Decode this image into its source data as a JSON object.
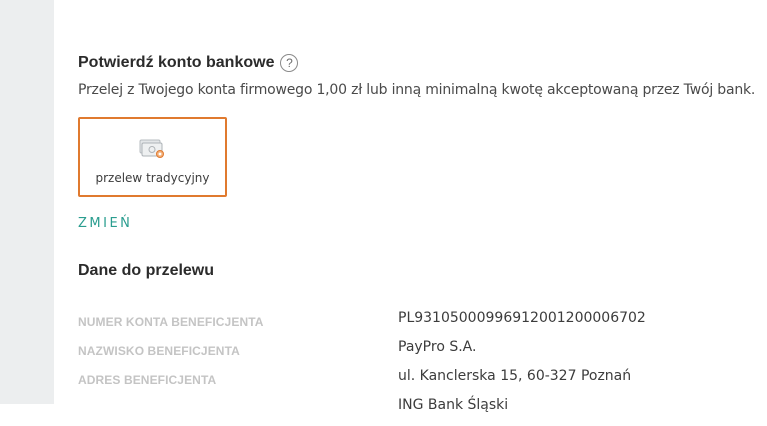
{
  "confirm": {
    "title": "Potwierdź konto bankowe",
    "help_glyph": "?",
    "subtitle": "Przelej z Twojego konta firmowego 1,00 zł lub inną minimalną kwotę akceptowaną przez Twój bank."
  },
  "method": {
    "icon": "money-bills-icon",
    "label": "przelew tradycyjny",
    "selected_border_color": "#e07a2f"
  },
  "change_link": "ZMIEŃ",
  "transfer": {
    "title": "Dane do przelewu",
    "rows": [
      {
        "label": "NUMER KONTA BENEFICJENTA",
        "value": "PL93105000996912001200006702"
      },
      {
        "label": "NAZWISKO BENEFICJENTA",
        "value": "PayPro S.A."
      },
      {
        "label": "ADRES BENEFICJENTA",
        "value": "ul. Kanclerska 15, 60-327 Poznań"
      },
      {
        "label": "",
        "value": "ING Bank Śląski"
      }
    ]
  },
  "colors": {
    "accent_link": "#2a9d8f",
    "label_gray": "#c4c4c4",
    "sidebar_bg": "#eceeef"
  }
}
